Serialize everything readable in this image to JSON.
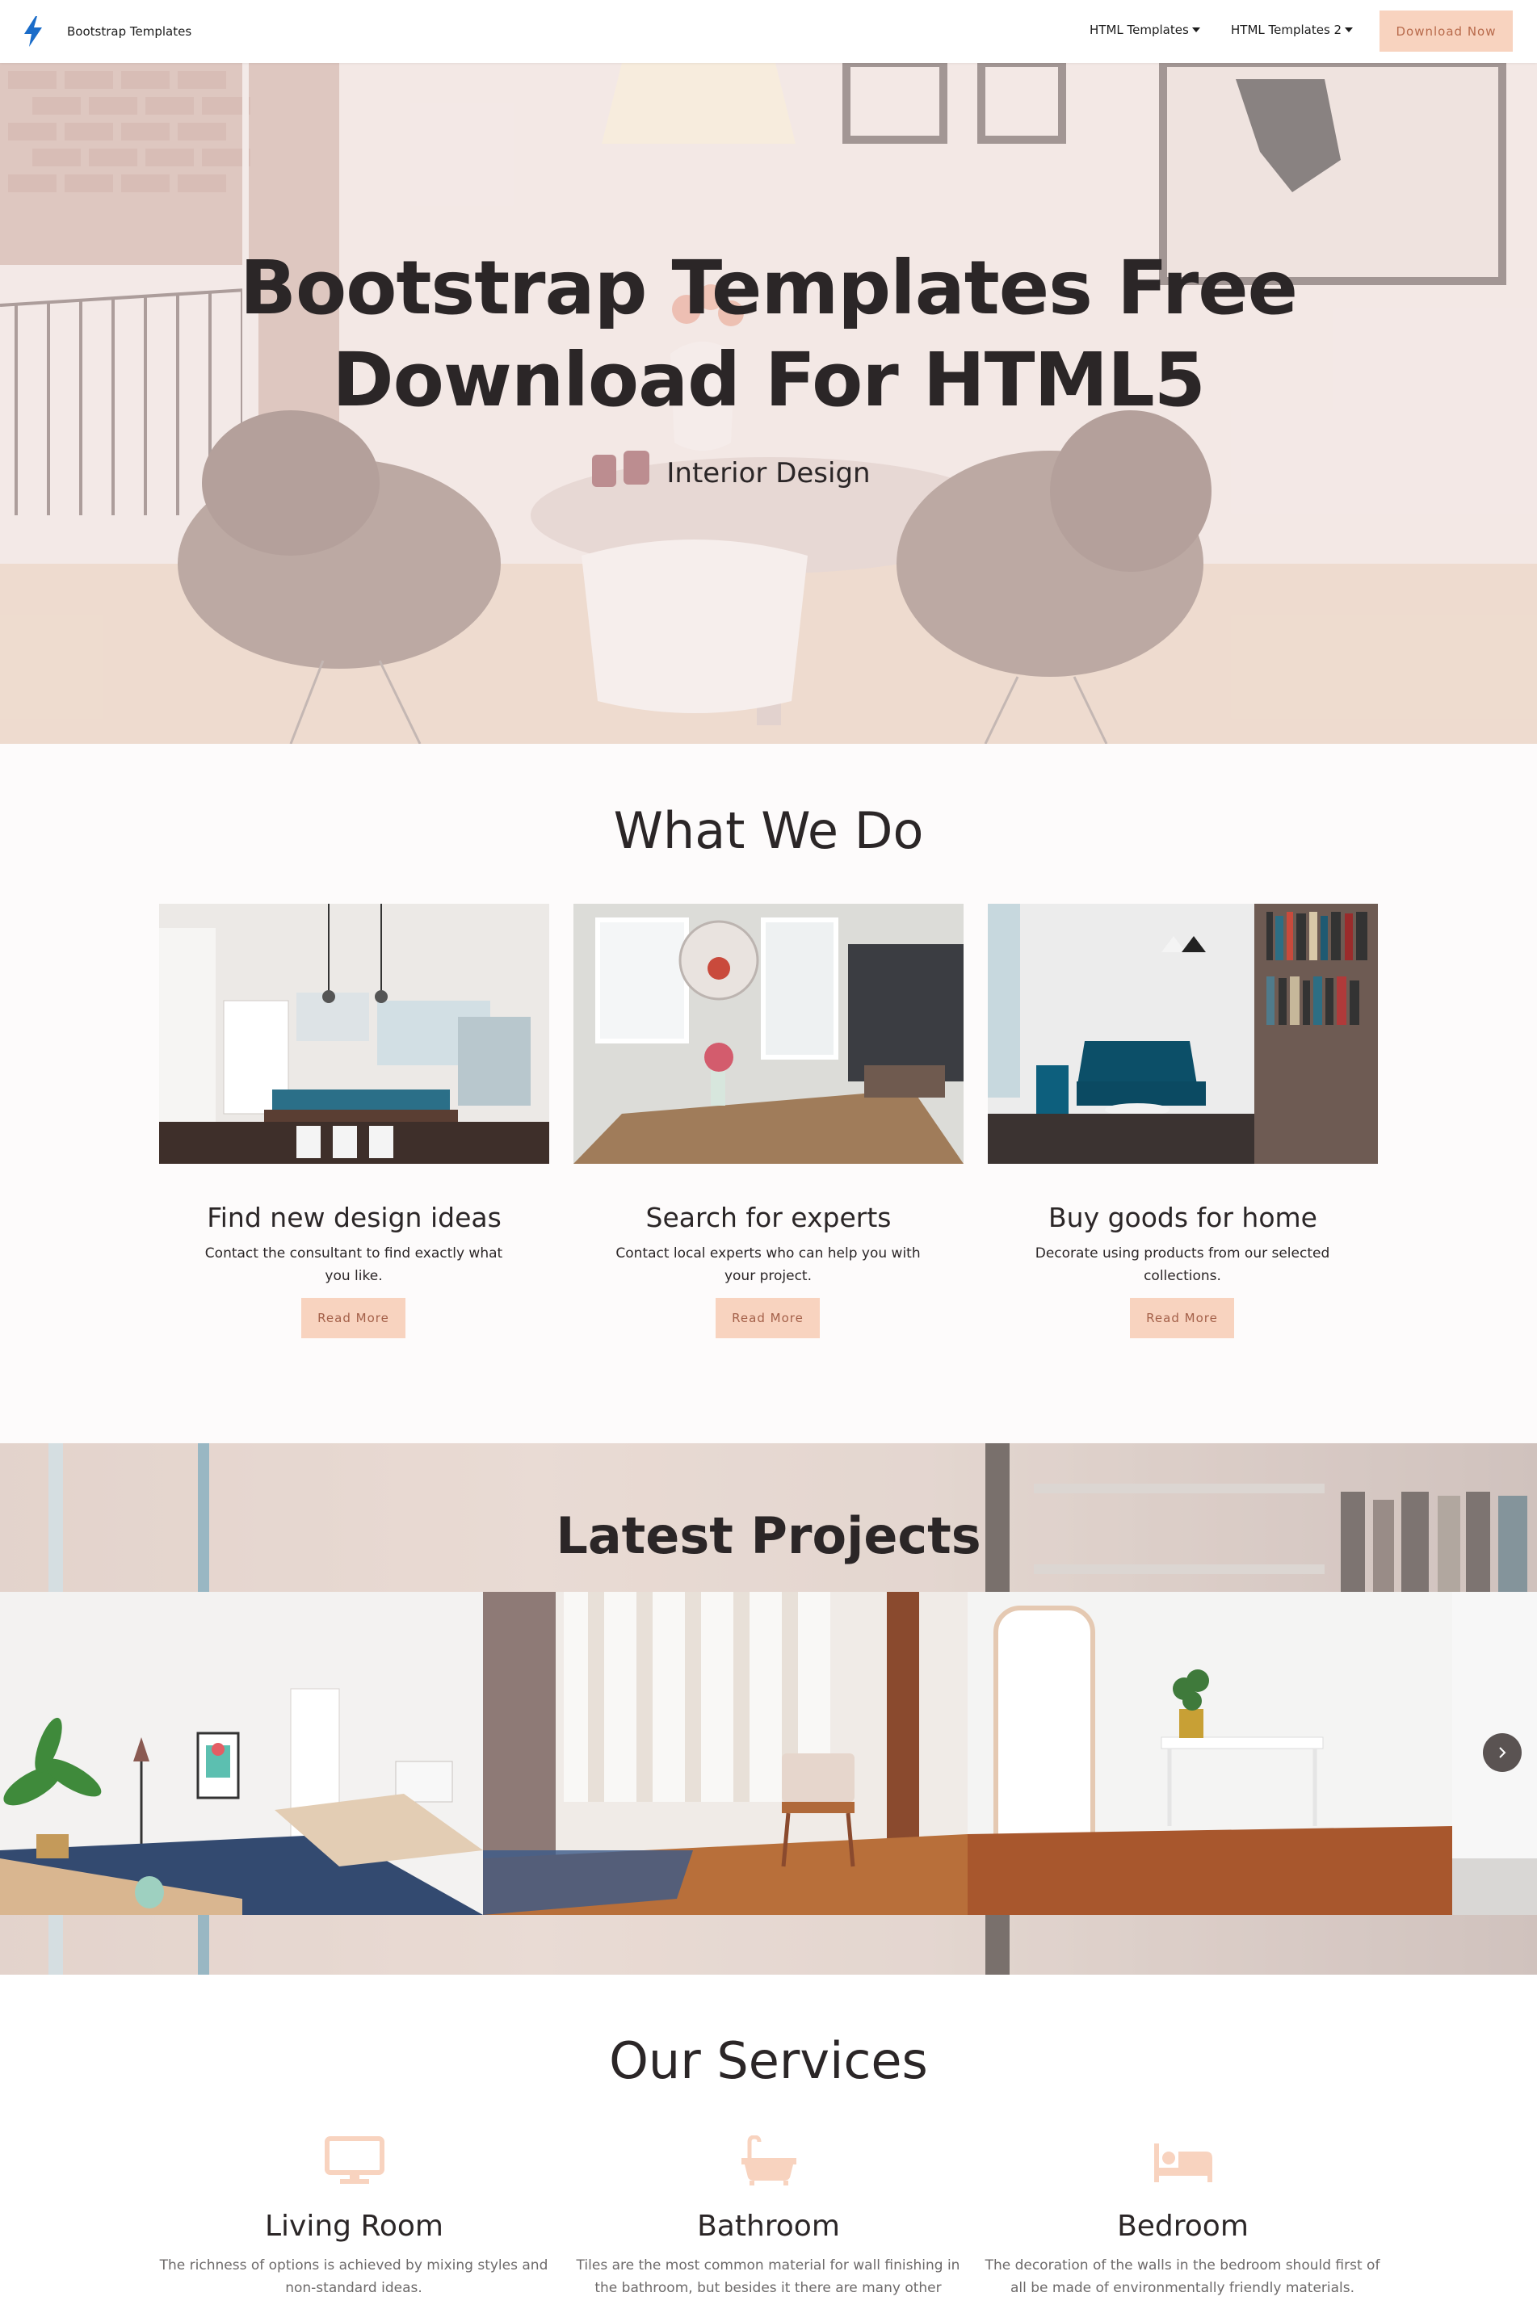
{
  "colors": {
    "accent": "#f8d3bf",
    "accent_text": "#a46049",
    "heading": "#2b2627",
    "brand_icon": "#1a6cc9",
    "muted_text": "#6d6a6a"
  },
  "navbar": {
    "brand_icon": "lightning-bolt-icon",
    "brand_name": "Bootstrap Templates",
    "links": [
      {
        "label": "HTML Templates",
        "icon": "caret-down-icon"
      },
      {
        "label": "HTML Templates 2",
        "icon": "caret-down-icon"
      }
    ],
    "cta_label": "Download Now"
  },
  "hero": {
    "title_line1": "Bootstrap Templates Free",
    "title_line2": "Download For HTML5",
    "subtitle": "Interior Design"
  },
  "what_we_do": {
    "title": "What We Do",
    "cards": [
      {
        "title": "Find new design ideas",
        "text_line1": "Contact the consultant to find exactly what",
        "text_line2": "you like.",
        "button": "Read More"
      },
      {
        "title": "Search for experts",
        "text_line1": "Contact local experts who can help you with",
        "text_line2": "your project.",
        "button": "Read More"
      },
      {
        "title": "Buy goods for home",
        "text_line1": "Decorate using products from our selected",
        "text_line2": "collections.",
        "button": "Read More"
      }
    ]
  },
  "latest_projects": {
    "title": "Latest Projects",
    "next_icon": "chevron-right-icon"
  },
  "our_services": {
    "title": "Our Services",
    "services": [
      {
        "icon": "monitor-icon",
        "title": "Living Room",
        "text_line1": "The richness of options is achieved by mixing styles and",
        "text_line2": "non-standard ideas."
      },
      {
        "icon": "bathtub-icon",
        "title": "Bathroom",
        "text_line1": "Tiles are the most common material for wall finishing in",
        "text_line2": "the bathroom, but besides it there are many other"
      },
      {
        "icon": "bed-icon",
        "title": "Bedroom",
        "text_line1": "The decoration of the walls in the bedroom should first of",
        "text_line2": "all be made of environmentally friendly materials."
      }
    ]
  }
}
